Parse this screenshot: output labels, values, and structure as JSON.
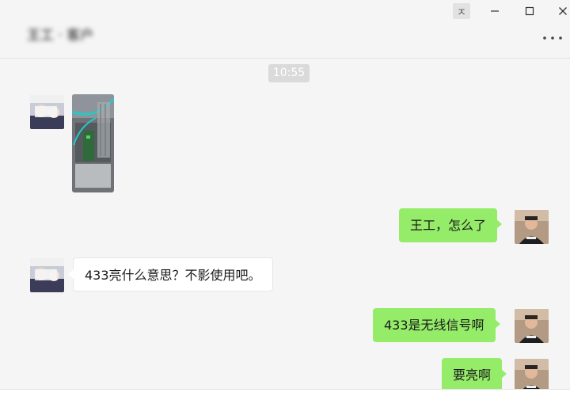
{
  "header": {
    "chat_title": "王工 · 客户",
    "pin_glyph": "ㅈ",
    "min_icon": "minimize-icon",
    "max_icon": "maximize-icon",
    "close_icon": "close-icon",
    "more_icon": "more-icon"
  },
  "chat": {
    "time": "10:55",
    "messages": [
      {
        "side": "other",
        "type": "image",
        "icon": "control-cabinet-photo"
      },
      {
        "side": "self",
        "type": "text",
        "text": "王工，怎么了"
      },
      {
        "side": "other",
        "type": "text",
        "text": "433亮什么意思？不影使用吧。"
      },
      {
        "side": "self",
        "type": "text",
        "text": "433是无线信号啊"
      },
      {
        "side": "self",
        "type": "text",
        "text": "要亮啊"
      }
    ]
  },
  "colors": {
    "self_bubble": "#95ec69",
    "other_bubble": "#ffffff",
    "background": "#f5f5f5",
    "time_badge": "#dadada"
  }
}
